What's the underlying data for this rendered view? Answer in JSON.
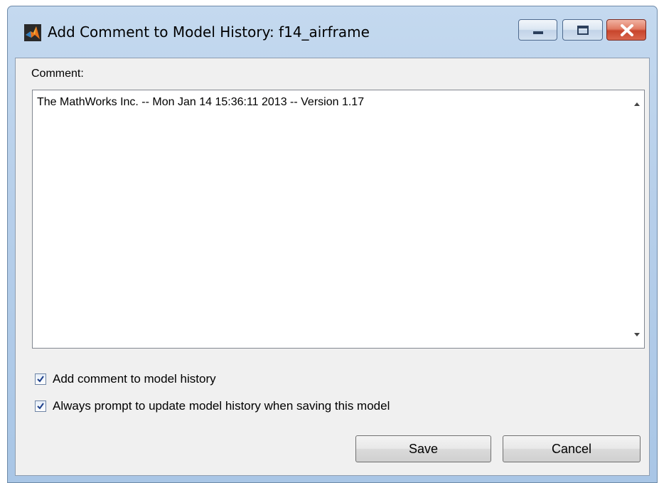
{
  "window": {
    "title": "Add Comment to Model History: f14_airframe",
    "icon": "matlab-icon"
  },
  "comment": {
    "label": "Comment:",
    "text": "The MathWorks Inc. -- Mon Jan 14 15:36:11 2013 -- Version 1.17"
  },
  "options": [
    {
      "label": "Add comment to model history",
      "checked": true
    },
    {
      "label": "Always prompt to update model history when saving this model",
      "checked": true
    }
  ],
  "buttons": {
    "save": "Save",
    "cancel": "Cancel"
  },
  "colors": {
    "frame": "#b7cfea",
    "client": "#f0f0f0",
    "close_button": "#c8452c"
  }
}
